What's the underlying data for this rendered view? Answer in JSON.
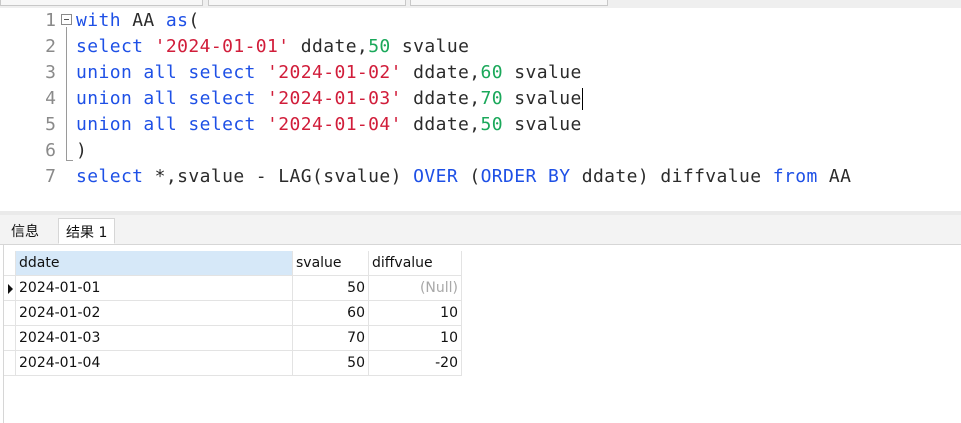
{
  "editor": {
    "lines": [
      {
        "num": "1",
        "tokens": [
          {
            "t": "with",
            "c": "kw"
          },
          {
            "t": " AA ",
            "c": "op"
          },
          {
            "t": "as",
            "c": "kw"
          },
          {
            "t": "(",
            "c": "op"
          }
        ]
      },
      {
        "num": "2",
        "tokens": [
          {
            "t": "select ",
            "c": "kw"
          },
          {
            "t": "'2024-01-01'",
            "c": "str"
          },
          {
            "t": " ddate,",
            "c": "op"
          },
          {
            "t": "50",
            "c": "num"
          },
          {
            "t": " svalue",
            "c": "op"
          }
        ]
      },
      {
        "num": "3",
        "tokens": [
          {
            "t": "union all select ",
            "c": "kw"
          },
          {
            "t": "'2024-01-02'",
            "c": "str"
          },
          {
            "t": " ddate,",
            "c": "op"
          },
          {
            "t": "60",
            "c": "num"
          },
          {
            "t": " svalue",
            "c": "op"
          }
        ]
      },
      {
        "num": "4",
        "tokens": [
          {
            "t": "union all select ",
            "c": "kw"
          },
          {
            "t": "'2024-01-03'",
            "c": "str"
          },
          {
            "t": " ddate,",
            "c": "op"
          },
          {
            "t": "70",
            "c": "num"
          },
          {
            "t": " svalue",
            "c": "op"
          }
        ],
        "cursor": true
      },
      {
        "num": "5",
        "tokens": [
          {
            "t": "union all select ",
            "c": "kw"
          },
          {
            "t": "'2024-01-04'",
            "c": "str"
          },
          {
            "t": " ddate,",
            "c": "op"
          },
          {
            "t": "50",
            "c": "num"
          },
          {
            "t": " svalue",
            "c": "op"
          }
        ]
      },
      {
        "num": "6",
        "tokens": [
          {
            "t": ")",
            "c": "op"
          }
        ]
      },
      {
        "num": "7",
        "tokens": [
          {
            "t": "select ",
            "c": "kw"
          },
          {
            "t": "*,svalue - LAG(svalue) ",
            "c": "op"
          },
          {
            "t": "OVER",
            "c": "kw"
          },
          {
            "t": " (",
            "c": "op"
          },
          {
            "t": "ORDER BY",
            "c": "kw"
          },
          {
            "t": " ddate) diffvalue ",
            "c": "op"
          },
          {
            "t": "from",
            "c": "kw"
          },
          {
            "t": " AA",
            "c": "op"
          }
        ]
      }
    ]
  },
  "result_tabs": {
    "info": "信息",
    "result": "结果 1"
  },
  "grid": {
    "columns": [
      "ddate",
      "svalue",
      "diffvalue"
    ],
    "rows": [
      {
        "ddate": "2024-01-01",
        "svalue": "50",
        "diffvalue": "(Null)",
        "null": true
      },
      {
        "ddate": "2024-01-02",
        "svalue": "60",
        "diffvalue": "10"
      },
      {
        "ddate": "2024-01-03",
        "svalue": "70",
        "diffvalue": "10"
      },
      {
        "ddate": "2024-01-04",
        "svalue": "50",
        "diffvalue": "-20"
      }
    ]
  },
  "colors": {
    "keyword": "#1e50e6",
    "string": "#d11d3a",
    "number": "#1aa85a",
    "selected_header": "#d6e8f8"
  }
}
